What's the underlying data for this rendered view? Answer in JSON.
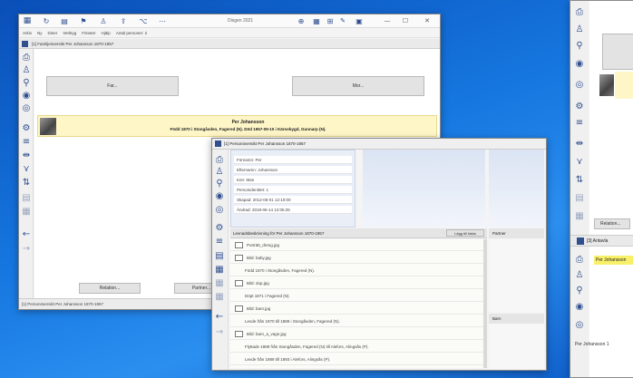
{
  "win1": {
    "title": "Disgen 2021",
    "menu": [
      "Arkiv",
      "Ny",
      "Diner",
      "Verktyg",
      "Fönster",
      "Hjälp",
      "Antal personer: 2"
    ],
    "tab_title": "[1] Familjeöversikt Per Johansson 1870-1957",
    "father_button": "Far...",
    "mother_button": "Mor...",
    "person_name": "Per Johansson",
    "person_detail": "Född 1870 i Stongåsden, Fagered (N). Död 1957-09-10 i Kärnebygd, Gunnarp (N).",
    "relation_button": "Relation...",
    "partner_button": "Partner...",
    "status": "[1] Personöversikt Per Johansson 1870-1957"
  },
  "win2": {
    "title": "[1] Personöversikt Per Johansson 1870-1957",
    "fields": [
      "Förnamn: Per",
      "Efternamn: Johansson",
      "Kön: Man",
      "Personidentitet: 1",
      "Skapad: 2012-06-01 12:10:00",
      "Ändrad: 2018-06-14 12:05:25"
    ],
    "lifespan_title": "Levnadsbeskrivning för Per Johansson 1870-1957",
    "add_fact_button": "Lägg till fakta",
    "rows": [
      {
        "text": "Porträtt_dreng.jpg",
        "thumb": true
      },
      {
        "text": "Bild: baby.jpg",
        "thumb": true
      },
      {
        "text": "Född 1870 i Stongåsden, Fagered (N).",
        "thumb": false
      },
      {
        "text": "Bild: dop.jpg",
        "thumb": true
      },
      {
        "text": "Döpt 1871 i Fagered (N).",
        "thumb": false
      },
      {
        "text": "Bild: barn.jpg",
        "thumb": true
      },
      {
        "text": "Levde från 1870 till 1889 i Stongåsden, Fagered (N).",
        "thumb": false
      },
      {
        "text": "Bild: barn_a_vagn.jpg",
        "thumb": true
      },
      {
        "text": "Flyttade 1889 från Stongåsden, Fagered (N) till Alefors, Alingsås (P).",
        "thumb": false
      },
      {
        "text": "Levde från 1889 till 1893 i Alefors, Alingsås (P).",
        "thumb": false
      }
    ],
    "partner_label": "Partner",
    "children_label": "Barn"
  },
  "win3": {
    "relation_button": "Relation...",
    "tab_title": "[3] Antavla",
    "person_name": "Per Johansson",
    "status": "Per Johansson 1"
  },
  "colors": {
    "highlight": "#fff6c8",
    "accent": "#2f4f8f",
    "desktop": "#1677e0"
  }
}
